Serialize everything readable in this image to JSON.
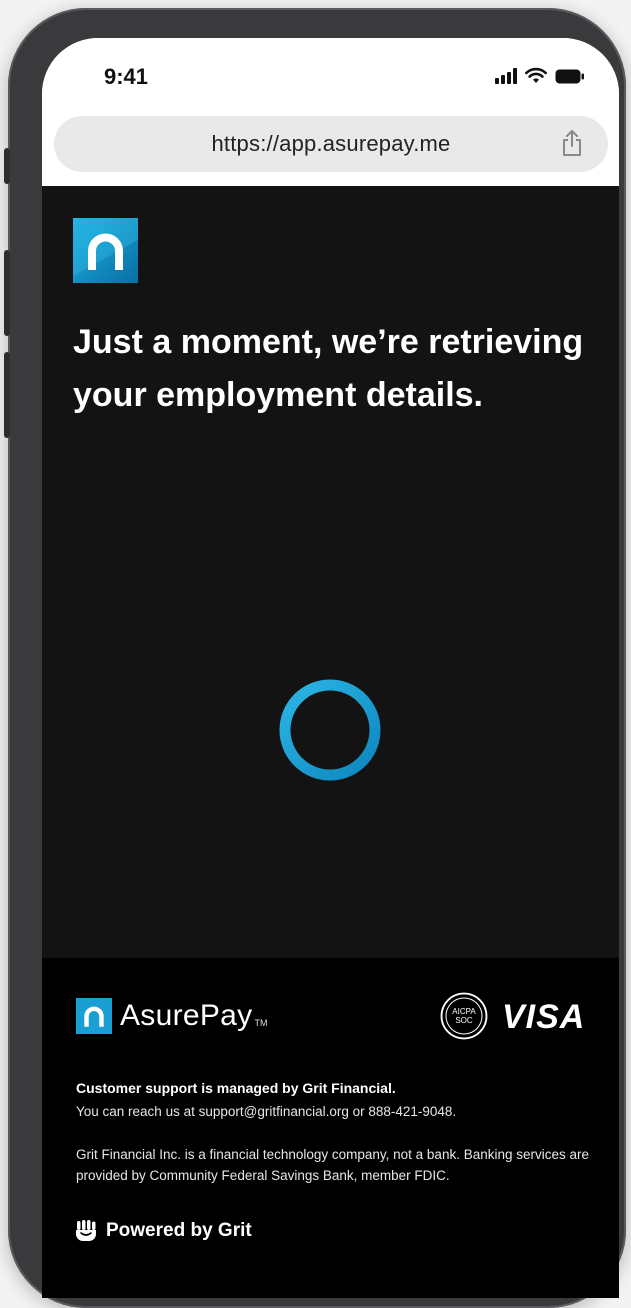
{
  "status_bar": {
    "time": "9:41",
    "icons": [
      "signal-icon",
      "wifi-icon",
      "battery-icon"
    ]
  },
  "browser": {
    "url": "https://app.asurepay.me",
    "share_icon": "share-icon"
  },
  "main": {
    "logo_icon": "asurepay-logo-icon",
    "headline": "Just a moment, we’re retrieving your employment details.",
    "spinner_icon": "loading-spinner-icon"
  },
  "footer": {
    "brand": "AsurePay",
    "trademark": "TM",
    "aicpa_badge_icon": "aicpa-soc-badge",
    "aicpa_text_1": "AICPA",
    "aicpa_text_2": "SOC",
    "visa": "VISA",
    "support_title": "Customer support is managed by Grit Financial.",
    "support_line": "You can reach us at support@gritfinancial.org or 888-421-9048.",
    "disclaimer": "Grit Financial Inc. is a financial technology company, not a bank. Banking services are provided by Community Federal Savings Bank, member FDIC.",
    "powered_by": "Powered by Grit",
    "grit_icon": "grit-hand-icon"
  },
  "colors": {
    "content_bg": "#131313",
    "footer_bg": "#000000",
    "accent": "#1aa3d6",
    "logo_teal": "#0e8fc4"
  }
}
